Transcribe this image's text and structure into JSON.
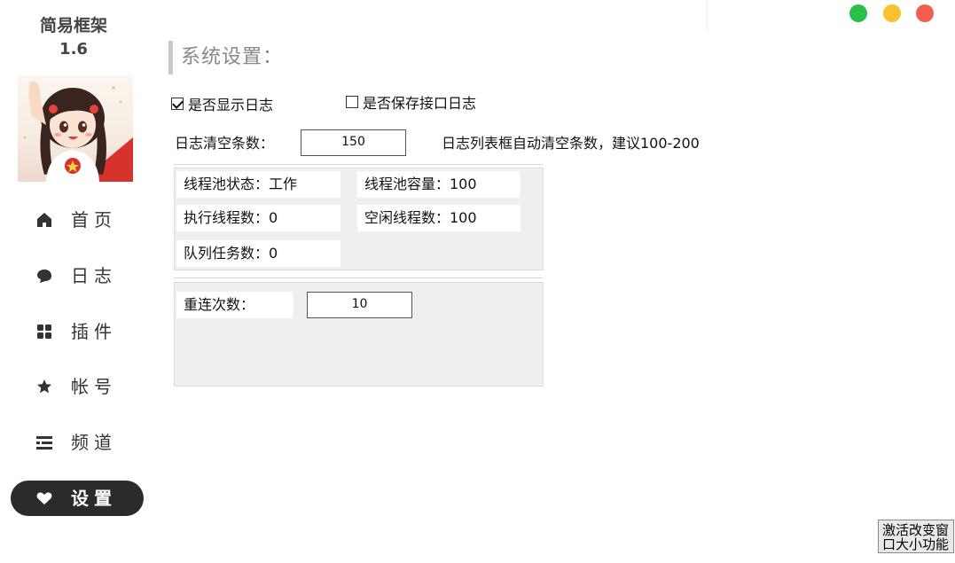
{
  "app": {
    "title": "简易框架",
    "version": "1.6"
  },
  "sidebar": {
    "items": [
      {
        "label": "首页",
        "icon": "home-icon",
        "active": false
      },
      {
        "label": "日志",
        "icon": "chat-bubble-icon",
        "active": false
      },
      {
        "label": "插件",
        "icon": "grid-icon",
        "active": false
      },
      {
        "label": "帐号",
        "icon": "star-icon",
        "active": false
      },
      {
        "label": "频道",
        "icon": "list-icon",
        "active": false
      },
      {
        "label": "设置",
        "icon": "heart-icon",
        "active": true
      }
    ]
  },
  "window_controls": {
    "colors": [
      "#2bbf4b",
      "#f9c02f",
      "#f35f4f"
    ]
  },
  "settings": {
    "title": "系统设置：",
    "show_log": {
      "label": "是否显示日志",
      "checked": true
    },
    "save_api_log": {
      "label": "是否保存接口日志",
      "checked": false
    },
    "log_clear_count": {
      "label": "日志清空条数：",
      "value": "150",
      "hint": "日志列表框自动清空条数，建议100-200"
    },
    "thread_pool": {
      "status": "线程池状态：工作",
      "capacity": "线程池容量：100",
      "running": "执行线程数：0",
      "idle": "空闲线程数：100",
      "queue": "队列任务数：0"
    },
    "reconnect": {
      "label": "重连次数：",
      "value": "10"
    }
  },
  "resize_button": {
    "label": "激活改变窗口大小功能"
  }
}
